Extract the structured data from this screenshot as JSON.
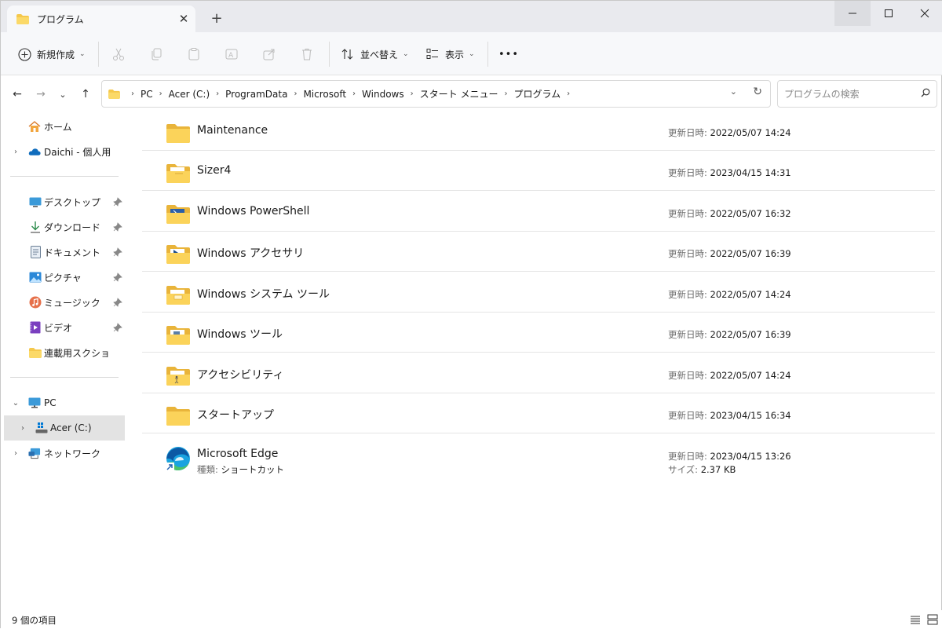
{
  "tab": {
    "title": "プログラム"
  },
  "toolbar": {
    "new_label": "新規作成",
    "sort_label": "並べ替え",
    "view_label": "表示",
    "more_label": "•••"
  },
  "address": {
    "crumbs": [
      "PC",
      "Acer (C:)",
      "ProgramData",
      "Microsoft",
      "Windows",
      "スタート メニュー",
      "プログラム"
    ]
  },
  "search": {
    "placeholder": "プログラムの検索"
  },
  "sidebar": {
    "home": "ホーム",
    "onedrive": "Daichi - 個人用",
    "quick": [
      {
        "label": "デスクトップ",
        "icon": "desktop-icon"
      },
      {
        "label": "ダウンロード",
        "icon": "download-icon"
      },
      {
        "label": "ドキュメント",
        "icon": "document-icon"
      },
      {
        "label": "ピクチャ",
        "icon": "pictures-icon"
      },
      {
        "label": "ミュージック",
        "icon": "music-icon"
      },
      {
        "label": "ビデオ",
        "icon": "video-icon"
      },
      {
        "label": "連載用スクショ",
        "icon": "folder-icon"
      }
    ],
    "pc": "PC",
    "drive": "Acer (C:)",
    "network": "ネットワーク"
  },
  "files": [
    {
      "name": "Maintenance",
      "date_label": "更新日時:",
      "date": "2022/05/07 14:24",
      "icon": "folder"
    },
    {
      "name": "Sizer4",
      "date_label": "更新日時:",
      "date": "2023/04/15 14:31",
      "icon": "folder-doc"
    },
    {
      "name": "Windows PowerShell",
      "date_label": "更新日時:",
      "date": "2022/05/07 16:32",
      "icon": "folder-ps"
    },
    {
      "name": "Windows アクセサリ",
      "date_label": "更新日時:",
      "date": "2022/05/07 16:39",
      "icon": "folder-acc"
    },
    {
      "name": "Windows システム ツール",
      "date_label": "更新日時:",
      "date": "2022/05/07 14:24",
      "icon": "folder-sys"
    },
    {
      "name": "Windows ツール",
      "date_label": "更新日時:",
      "date": "2022/05/07 16:39",
      "icon": "folder-tools"
    },
    {
      "name": "アクセシビリティ",
      "date_label": "更新日時:",
      "date": "2022/05/07 14:24",
      "icon": "folder-access"
    },
    {
      "name": "スタートアップ",
      "date_label": "更新日時:",
      "date": "2023/04/15 16:34",
      "icon": "folder"
    },
    {
      "name": "Microsoft Edge",
      "date_label": "更新日時:",
      "date": "2023/04/15 13:26",
      "icon": "edge",
      "type_label": "種類:",
      "type": "ショートカット",
      "size_label": "サイズ:",
      "size": "2.37 KB"
    }
  ],
  "status": {
    "count": "9 個の項目"
  },
  "colors": {
    "folder": "#f5c84c",
    "folder_dark": "#e9b43a",
    "accent": "#0067c0"
  }
}
